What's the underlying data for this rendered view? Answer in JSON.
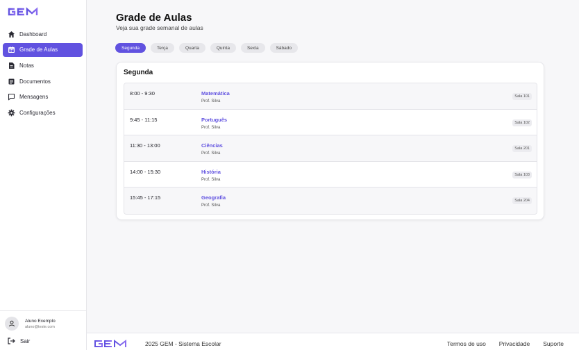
{
  "brand": {
    "name": "GEM",
    "accent": "#6152e0"
  },
  "sidebar": {
    "items": [
      {
        "label": "Dashboard",
        "icon": "home-icon",
        "active": false
      },
      {
        "label": "Grade de Aulas",
        "icon": "calendar-icon",
        "active": true
      },
      {
        "label": "Notas",
        "icon": "document-icon",
        "active": false
      },
      {
        "label": "Documentos",
        "icon": "folder-icon",
        "active": false
      },
      {
        "label": "Mensagens",
        "icon": "message-icon",
        "active": false
      },
      {
        "label": "Configurações",
        "icon": "gear-icon",
        "active": false
      }
    ],
    "user": {
      "name": "Aluno Exemplo",
      "email": "aluno@teste.com"
    },
    "logout_label": "Sair"
  },
  "main": {
    "title": "Grade de Aulas",
    "subtitle": "Veja sua grade semanal de aulas",
    "days": [
      "Segunda",
      "Terça",
      "Quarta",
      "Quinta",
      "Sexta",
      "Sábado"
    ],
    "active_day": "Segunda",
    "schedule": {
      "day_title": "Segunda",
      "classes": [
        {
          "time": "8:00 - 9:30",
          "subject": "Matemática",
          "teacher": "Prof. Silva",
          "room": "Sala 101"
        },
        {
          "time": "9:45 - 11:15",
          "subject": "Português",
          "teacher": "Prof. Silva",
          "room": "Sala 102"
        },
        {
          "time": "11:30 - 13:00",
          "subject": "Ciências",
          "teacher": "Prof. Silva",
          "room": "Sala 201"
        },
        {
          "time": "14:00 - 15:30",
          "subject": "História",
          "teacher": "Prof. Silva",
          "room": "Sala 103"
        },
        {
          "time": "15:45 - 17:15",
          "subject": "Geografia",
          "teacher": "Prof. Silva",
          "room": "Sala 204"
        }
      ]
    }
  },
  "footer": {
    "copyright": "2025 GEM - Sistema Escolar",
    "links": [
      "Termos de uso",
      "Privacidade",
      "Suporte"
    ]
  }
}
